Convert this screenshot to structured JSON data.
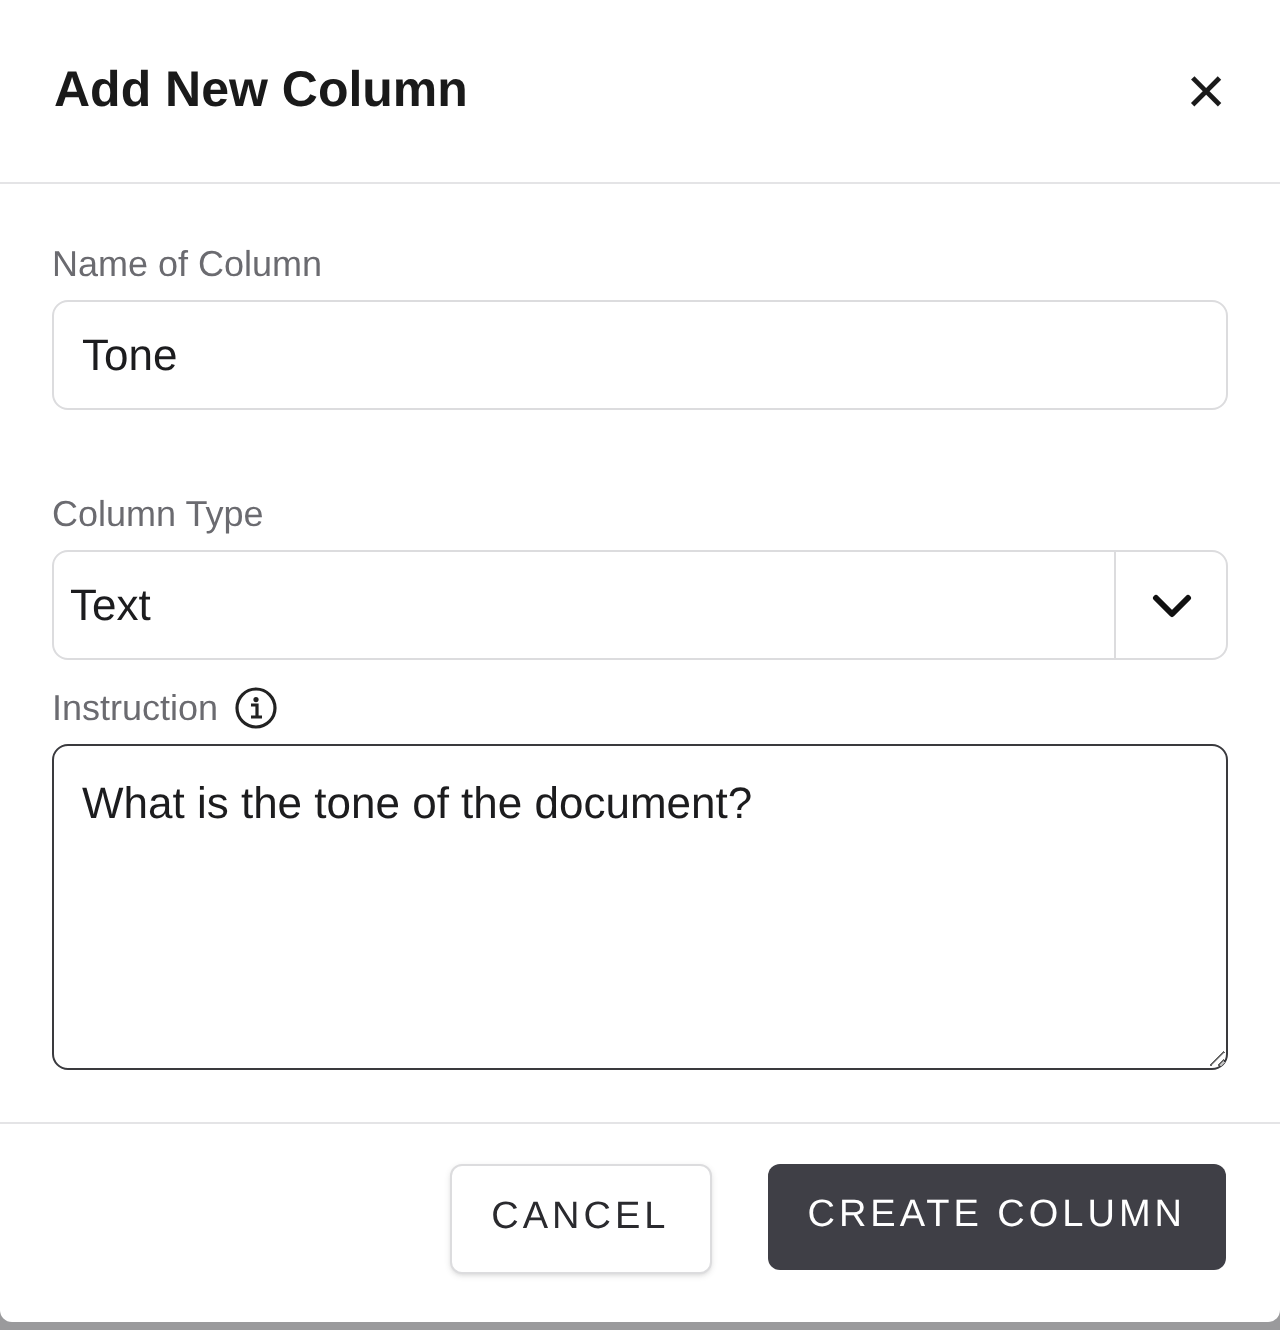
{
  "dialog": {
    "title": "Add New Column",
    "close": "×"
  },
  "fields": [
    {
      "kind": "text",
      "label": "Name of Column",
      "value": "Tone"
    },
    {
      "kind": "select",
      "label": "Column Type",
      "value": "Text"
    },
    {
      "kind": "textarea",
      "label": "Instruction",
      "info": true,
      "value": "What is the tone of the document?"
    }
  ],
  "buttons": [
    {
      "label": "CANCEL",
      "primary": false
    },
    {
      "label": "CREATE COLUMN",
      "primary": true
    }
  ]
}
